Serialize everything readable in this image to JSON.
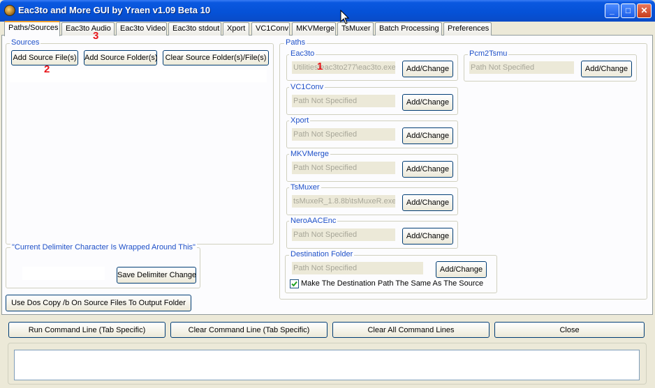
{
  "window": {
    "title": "Eac3to and More GUI by Yraen v1.09 Beta 10",
    "icon": "app-icon",
    "controls": {
      "minimize": "_",
      "maximize": "□",
      "close": "✕"
    }
  },
  "tabs": [
    {
      "label": "Paths/Sources",
      "active": true
    },
    {
      "label": "Eac3to Audio"
    },
    {
      "label": "Eac3to Video"
    },
    {
      "label": "Eac3to stdout"
    },
    {
      "label": "Xport"
    },
    {
      "label": "VC1Conv"
    },
    {
      "label": "MKVMerge"
    },
    {
      "label": "TsMuxer"
    },
    {
      "label": "Batch Processing"
    },
    {
      "label": "Preferences"
    }
  ],
  "sources": {
    "label": "Sources",
    "add_file_btn": "Add Source File(s)",
    "add_folder_btn": "Add Source Folder(s)",
    "clear_btn": "Clear Source Folder(s)/File(s)",
    "list_items": []
  },
  "delimiter": {
    "label": "\"Current Delimiter Character Is Wrapped Around This\"",
    "value": "",
    "save_btn": "Save Delimiter Change"
  },
  "dos_copy_btn": "Use Dos Copy /b On Source Files To Output Folder",
  "paths": {
    "label": "Paths",
    "change_btn": "Add/Change",
    "eac3to": {
      "label": "Eac3to",
      "value": "Utilities\\eac3to277\\eac3to.exe"
    },
    "pcm2tsmu": {
      "label": "Pcm2Tsmu",
      "value": "Path Not Specified"
    },
    "vc1conv": {
      "label": "VC1Conv",
      "value": "Path Not Specified"
    },
    "xport": {
      "label": "Xport",
      "value": "Path Not Specified"
    },
    "mkvmerge": {
      "label": "MKVMerge",
      "value": "Path Not Specified"
    },
    "tsmuxer": {
      "label": "TsMuxer",
      "value": "tsMuxeR_1.8.8b\\tsMuxeR.exe"
    },
    "neroaacenc": {
      "label": "NeroAACEnc",
      "value": "Path Not Specified"
    },
    "destination": {
      "label": "Destination Folder",
      "value": "Path Not Specified",
      "same_as_source_label": "Make The Destination Path The Same As The Source",
      "same_as_source_checked": true
    }
  },
  "bottom_buttons": {
    "run": "Run Command Line (Tab Specific)",
    "clear": "Clear Command Line (Tab Specific)",
    "clear_all": "Clear All Command Lines",
    "close": "Close"
  },
  "command_output": "",
  "markers": {
    "m1": "1",
    "m2": "2",
    "m3": "3"
  },
  "colors": {
    "titlebar": "#0551d6",
    "group_label": "#1e50c8",
    "marker": "#e8151a",
    "window_bg": "#ece9d8"
  }
}
